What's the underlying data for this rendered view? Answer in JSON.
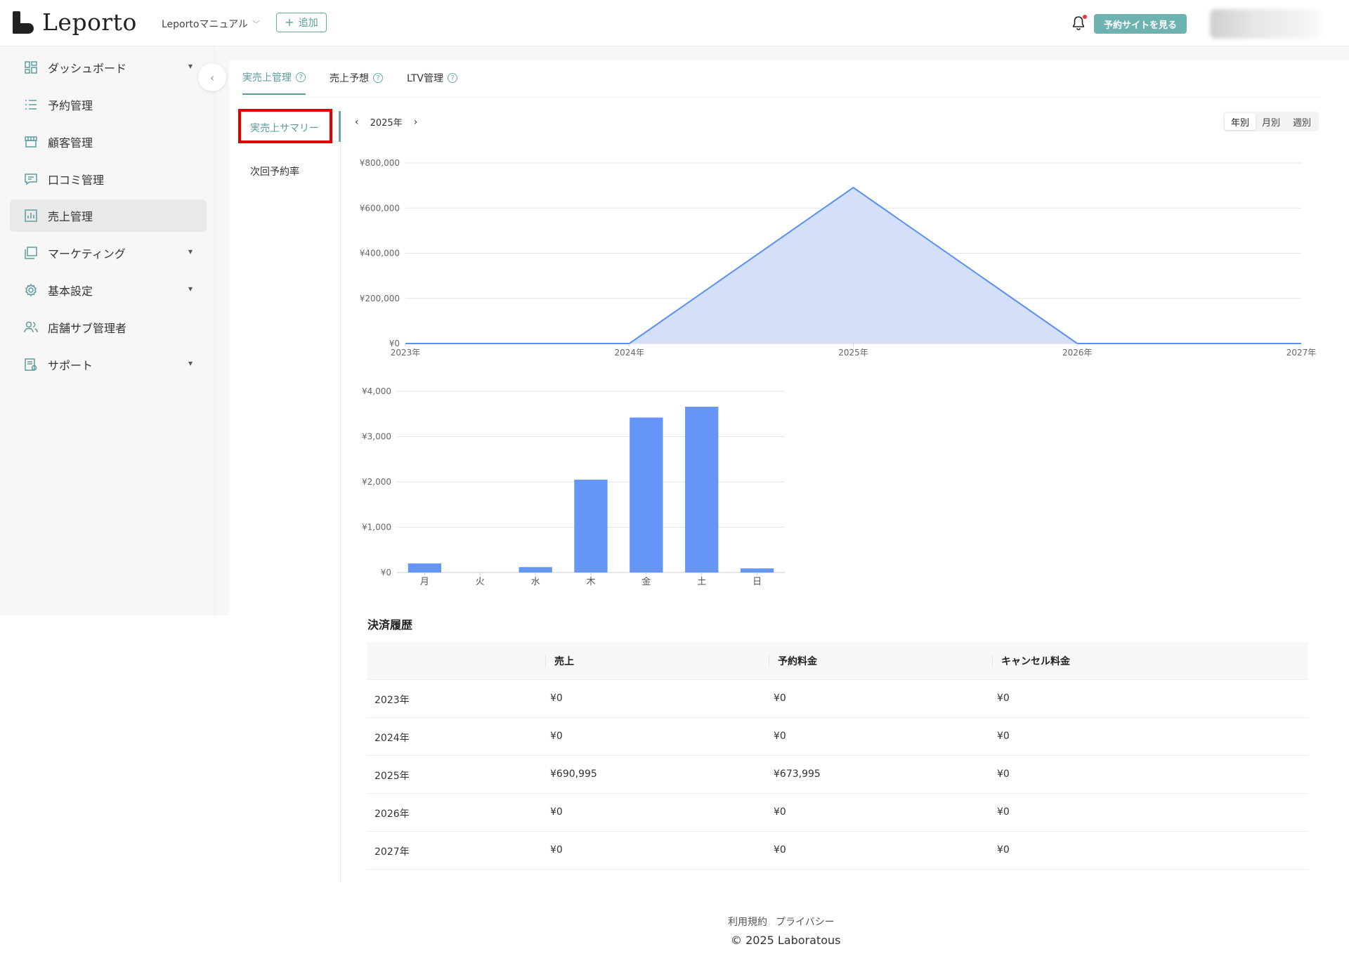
{
  "header": {
    "logo_text": "Leporto",
    "manual_select": "Leportoマニュアル",
    "add_label": "追加",
    "site_button": "予約サイトを見る"
  },
  "sidebar": {
    "items": [
      {
        "label": "ダッシュボード",
        "icon": "dashboard-icon",
        "chevron": true
      },
      {
        "label": "予約管理",
        "icon": "list-icon",
        "chevron": false
      },
      {
        "label": "顧客管理",
        "icon": "store-icon",
        "chevron": false
      },
      {
        "label": "口コミ管理",
        "icon": "comment-icon",
        "chevron": false
      },
      {
        "label": "売上管理",
        "icon": "chart-icon",
        "chevron": false,
        "active": true
      },
      {
        "label": "マーケティング",
        "icon": "copy-icon",
        "chevron": true
      },
      {
        "label": "基本設定",
        "icon": "gear-icon",
        "chevron": true
      },
      {
        "label": "店舗サブ管理者",
        "icon": "users-icon",
        "chevron": false
      },
      {
        "label": "サポート",
        "icon": "support-icon",
        "chevron": true
      }
    ]
  },
  "tabs": [
    {
      "label": "実売上管理",
      "active": true
    },
    {
      "label": "売上予想",
      "active": false
    },
    {
      "label": "LTV管理",
      "active": false
    }
  ],
  "submenu": {
    "summary": "実売上サマリー",
    "next_rate": "次回予約率"
  },
  "period": {
    "label": "2025年",
    "segments": [
      "年別",
      "月別",
      "週別"
    ],
    "selected": "年別"
  },
  "chart_data": [
    {
      "type": "area",
      "x": [
        "2023年",
        "2024年",
        "2025年",
        "2026年",
        "2027年"
      ],
      "series": [
        {
          "values": [
            0,
            0,
            690995,
            0,
            0
          ]
        }
      ],
      "y_ticks": [
        "¥800,000",
        "¥600,000",
        "¥400,000",
        "¥200,000",
        "¥0"
      ],
      "ylim": [
        0,
        800000
      ],
      "color": "#5b8ff0",
      "fill": "#d4e0fa"
    },
    {
      "type": "bar",
      "categories": [
        "月",
        "火",
        "水",
        "木",
        "金",
        "土",
        "日"
      ],
      "values": [
        200,
        0,
        120,
        2050,
        3420,
        3660,
        90
      ],
      "y_ticks": [
        "¥4,000",
        "¥3,000",
        "¥2,000",
        "¥1,000",
        "¥0"
      ],
      "ylim": [
        0,
        4000
      ],
      "color": "#6495f7"
    }
  ],
  "history": {
    "title": "決済履歴",
    "columns": [
      "",
      "売上",
      "予約料金",
      "キャンセル料金"
    ],
    "rows": [
      [
        "2023年",
        "¥0",
        "¥0",
        "¥0"
      ],
      [
        "2024年",
        "¥0",
        "¥0",
        "¥0"
      ],
      [
        "2025年",
        "¥690,995",
        "¥673,995",
        "¥0"
      ],
      [
        "2026年",
        "¥0",
        "¥0",
        "¥0"
      ],
      [
        "2027年",
        "¥0",
        "¥0",
        "¥0"
      ]
    ]
  },
  "footer": {
    "terms": "利用規約",
    "privacy": "プライバシー",
    "copyright": "© 2025 Laboratous"
  }
}
